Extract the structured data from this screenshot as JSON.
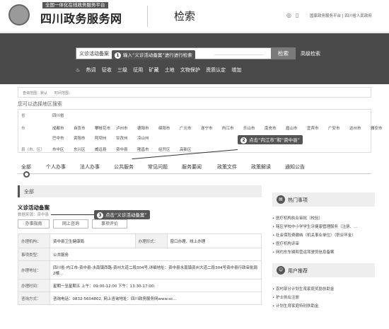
{
  "header": {
    "slogan": "全国一体化在线政务服务平台",
    "brand": "四川政务服务网",
    "page_title": "检索",
    "icons": [
      "weibo-icon",
      "mobile-icon"
    ],
    "links": "国家政务服务平台 | 四川省人民政府"
  },
  "search": {
    "value": "义诊活动备案",
    "button": "检索",
    "advanced": "高级检索",
    "hot_label": "热词",
    "hot_words": [
      "征收",
      "三级",
      "征用",
      "矿藏",
      "土地",
      "文物保护",
      "资质认定",
      "增加"
    ]
  },
  "callouts": {
    "c1_num": "1",
    "c1_text": "输入“义诊活动备案”进行进行检索",
    "c2_num": "2",
    "c2_text": "点击“内江市”和“资中县”",
    "c3_num": "3",
    "c3_text": "点击“义诊活动备案”"
  },
  "filter": {
    "text": "查询范围：默认　　时间范围："
  },
  "area": {
    "hint": "您可以选择地区搜索",
    "province_label": "省",
    "province": "四川省",
    "city_label": "市",
    "cities_row1": [
      "成都市",
      "自贡市",
      "攀枝花市",
      "泸州市",
      "德阳市",
      "绵阳市",
      "广元市",
      "遂宁市",
      "内江市",
      "乐山市",
      "南充市",
      "眉山市",
      "宜宾市",
      "广安市",
      "达州市",
      "雅安市"
    ],
    "cities_row2": [
      "巴中市",
      "资阳市",
      "阿坝州",
      "甘孜州",
      "凉山州"
    ],
    "county_label": "县（市、区）",
    "counties": [
      "市中区",
      "东兴区",
      "威远县",
      "资中县",
      "隆昌市",
      "经开区",
      "高新区"
    ]
  },
  "tabs": [
    "全部",
    "个人办事",
    "法人办事",
    "公共服务",
    "常见问题",
    "服务要闻",
    "政策文件",
    "政策解读",
    "通知公告"
  ],
  "result": {
    "section": "全部",
    "title": "义诊活动备案",
    "source": "数据来源：资中县",
    "buttons": [
      "办事指南",
      "网上咨询",
      "事项评价"
    ],
    "rows": [
      {
        "k1": "办理机构：",
        "v1": "资中县卫生健康局",
        "k2": "办理形式：",
        "v2": "窗口办理、线上办理"
      },
      {
        "k1": "事项类型：",
        "v1": "公共服务"
      },
      {
        "k1": "办理地址：",
        "v1": "四川省-内江市-资中县-水南镇西路-资州大道二段304号,详细地址：资中县水南镇资州大道二段304号资中县行政审批局2楼..."
      },
      {
        "k1": "办理时间：",
        "v1": "星期一至星期五 上午：09:00-12:00 下午：13:30-17:00;"
      },
      {
        "k1": "咨询方式：",
        "v1": "咨询电话：0832-5604802, 网上咨询地址：四川政务服务网www.sc..."
      }
    ]
  },
  "sidebar": {
    "hot_title": "热门事项",
    "hot_items": [
      "医疗机构执业审批（校验）",
      "辖区学校中小学学生牙健康管理服务（注册、...",
      "社会保险费缴纳（机关事业单位）（职业年金）",
      "医疗机构评审",
      "网约车车辆和营运驾驶员信息备案"
    ],
    "user_title": "用户推荐",
    "user_items": [
      "农村部分计划生育家庭奖励扶助金",
      "护士执业注册",
      "计划生育家庭特别扶助金"
    ]
  }
}
